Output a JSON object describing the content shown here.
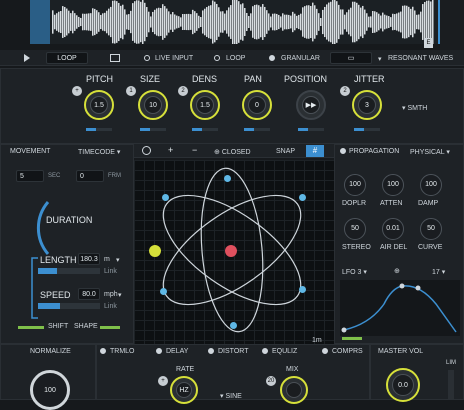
{
  "transport": {
    "loop": "LOOP",
    "live_input": "LIVE INPUT",
    "loop2": "LOOP",
    "granular": "GRANULAR",
    "resonant": "RESONANT WAVES",
    "marker": "E"
  },
  "knobs": [
    {
      "label": "PITCH",
      "value": "1.5",
      "badge": ""
    },
    {
      "label": "SIZE",
      "value": "10",
      "badge": "1"
    },
    {
      "label": "DENS",
      "value": "1.5",
      "badge": "2"
    },
    {
      "label": "PAN",
      "value": "0",
      "badge": ""
    },
    {
      "label": "POSITION",
      "value": "",
      "badge": ""
    },
    {
      "label": "JITTER",
      "value": "3",
      "badge": "2"
    }
  ],
  "smth": "SMTH",
  "movement": {
    "title": "MOVEMENT",
    "mode": "TIMECODE",
    "sec_val": "5",
    "sec_unit": "SEC",
    "frm_val": "0",
    "frm_unit": "FRM",
    "duration": "DURATION",
    "length_label": "LENGTH",
    "length_val": "180.3",
    "length_unit": "m",
    "length_link": "Link",
    "speed_label": "SPEED",
    "speed_val": "80.0",
    "speed_unit": "mph",
    "speed_link": "Link",
    "shift": "SHIFT",
    "shape": "SHAPE"
  },
  "toolbar": {
    "closed": "CLOSED",
    "snap": "SNAP",
    "zoom": "1m"
  },
  "propagation": {
    "title": "PROPAGATION",
    "mode": "PHYSICAL",
    "knobs": [
      {
        "label": "DOPLR",
        "value": "100"
      },
      {
        "label": "ATTEN",
        "value": "100"
      },
      {
        "label": "DAMP",
        "value": "100"
      },
      {
        "label": "STEREO",
        "value": "50"
      },
      {
        "label": "AIR DEL",
        "value": "0.01"
      },
      {
        "label": "CURVE",
        "value": "50"
      }
    ],
    "lfo": "LFO 3",
    "lfo_num": "17"
  },
  "bottom": {
    "normalize": "NORMALIZE",
    "norm_val": "100",
    "effects": [
      "TRMLO",
      "DELAY",
      "DISTORT",
      "EQULIZ",
      "COMPRS"
    ],
    "rate": "RATE",
    "mix": "MIX",
    "sine": "SINE",
    "hz": "HZ",
    "mix_badge": "20",
    "master": "MASTER VOL",
    "master_val": "0.0",
    "lim": "LIM"
  },
  "colors": {
    "accent": "#3c8fd0",
    "green": "#7fc04a",
    "yellow": "#d6e03a",
    "red": "#e0505e"
  }
}
